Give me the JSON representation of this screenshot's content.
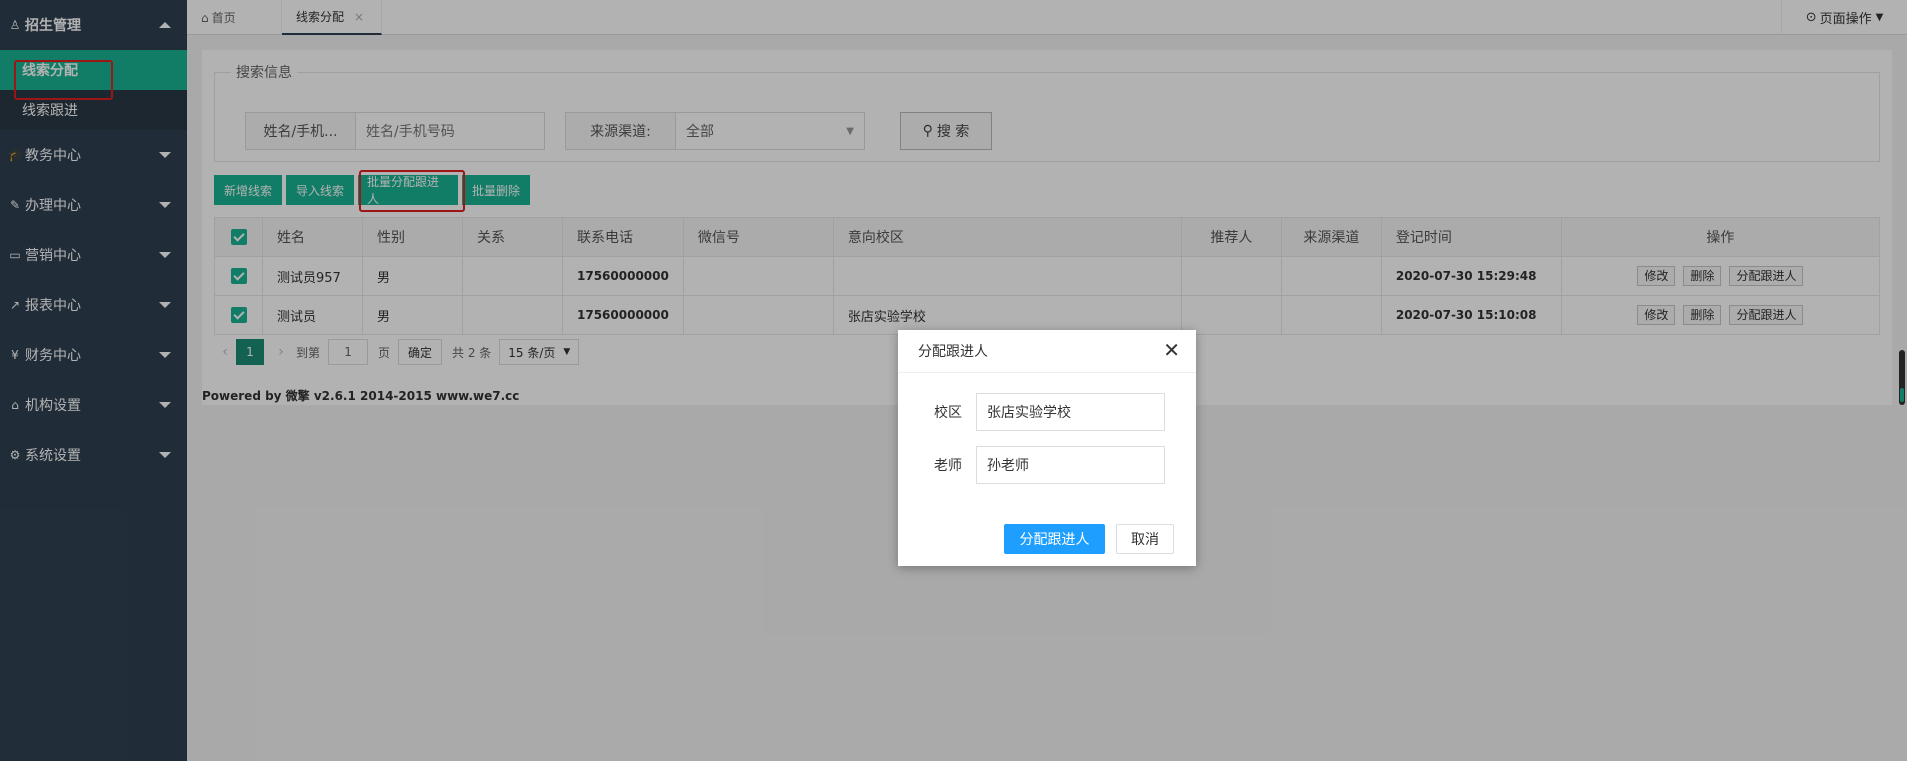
{
  "sidebar": {
    "items": [
      {
        "icon": "user-stamp-icon",
        "label": "招生管理"
      },
      {
        "icon": "graduation-cap-icon",
        "label": "教务中心"
      },
      {
        "icon": "edit-icon",
        "label": "办理中心"
      },
      {
        "icon": "laptop-icon",
        "label": "营销中心"
      },
      {
        "icon": "line-chart-icon",
        "label": "报表中心"
      },
      {
        "icon": "yen-icon",
        "label": "财务中心"
      },
      {
        "icon": "bank-icon",
        "label": "机构设置"
      },
      {
        "icon": "gears-icon",
        "label": "系统设置"
      }
    ],
    "sub": [
      "线索分配",
      "线索跟进"
    ]
  },
  "tabs": {
    "home": "首页",
    "current": "线索分配",
    "page_ops": "页面操作"
  },
  "search": {
    "legend": "搜索信息",
    "name_label": "姓名/手机...",
    "name_placeholder": "姓名/手机号码",
    "channel_label": "来源渠道:",
    "channel_value": "全部",
    "button": "搜 索"
  },
  "toolbar": {
    "add": "新增线索",
    "import": "导入线索",
    "batch_assign": "批量分配跟进人",
    "batch_delete": "批量删除"
  },
  "table": {
    "headers": [
      "姓名",
      "性别",
      "关系",
      "联系电话",
      "微信号",
      "意向校区",
      "推荐人",
      "来源渠道",
      "登记时间",
      "操作"
    ],
    "rows": [
      {
        "name": "测试员957",
        "gender": "男",
        "relation": "",
        "phone": "17560000000",
        "wechat": "",
        "campus": "",
        "referrer": "",
        "channel": "",
        "time": "2020-07-30 15:29:48"
      },
      {
        "name": "测试员",
        "gender": "男",
        "relation": "",
        "phone": "17560000000",
        "wechat": "",
        "campus": "张店实验学校",
        "referrer": "",
        "channel": "",
        "time": "2020-07-30 15:10:08"
      }
    ],
    "actions": {
      "edit": "修改",
      "delete": "删除",
      "assign": "分配跟进人"
    }
  },
  "pager": {
    "current_page": "1",
    "goto_label": "到第",
    "goto_value": "1",
    "page_unit": "页",
    "confirm": "确定",
    "total": "共 2 条",
    "page_size": "15 条/页"
  },
  "footer": {
    "powered": "Powered by 微擎 v2.6.1 2014-2015 www.we7.cc"
  },
  "modal": {
    "title": "分配跟进人",
    "campus_label": "校区",
    "campus_value": "张店实验学校",
    "teacher_label": "老师",
    "teacher_value": "孙老师",
    "ok": "分配跟进人",
    "cancel": "取消"
  },
  "colors": {
    "sidebar": "#2f4050",
    "accent": "#1ab394",
    "primary": "#1e9fff",
    "highlight": "#e02020"
  }
}
